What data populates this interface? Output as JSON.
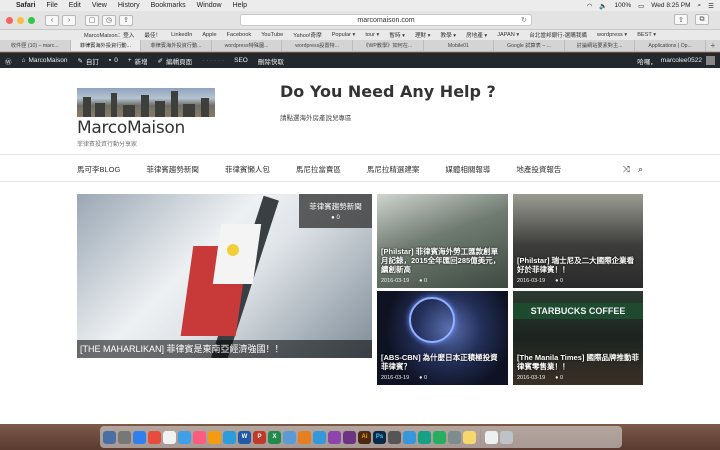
{
  "menubar": {
    "app": "Safari",
    "items": [
      "File",
      "Edit",
      "View",
      "History",
      "Bookmarks",
      "Window",
      "Help"
    ],
    "battery": "100%",
    "clock": "Wed 8:25 PM"
  },
  "toolbar": {
    "url": "marcomaison.com"
  },
  "bookmarks": [
    "MarcoMaison：登入",
    "最佳！",
    "LinkedIn",
    "Apple",
    "Facebook",
    "YouTube",
    "Yahoo!奇摩",
    "Popular ▾",
    "tour ▾",
    "暫時 ▾",
    "理財 ▾",
    "教學 ▾",
    "房地產 ▾",
    "JAPAN ▾",
    "台北當邦銀行-選購我備",
    "wordpress ▾",
    "BEST ▾"
  ],
  "tabs": [
    "收件匣 (10) – marc...",
    "菲律賓海外投資行動...",
    "菲律賓海外投資行動...",
    "wordpress特殊圖...",
    "wordpress設置特...",
    "《WP教學》如何在...",
    "Mobile01",
    "Google 試算表 – ...",
    "討論網站要素對主...",
    "Applications | Op..."
  ],
  "wpbar": {
    "site": "MarcoMaison",
    "customize": "自訂",
    "comments": "0",
    "new": "新增",
    "edit": "編輯頁面",
    "seo": "SEO",
    "cache": "刪除快取",
    "greeting": "哈囉，",
    "user": "marcolee0522"
  },
  "site": {
    "title": "MarcoMaison",
    "tagline": "菲律賓投資行動分享家",
    "ad_title": "Do You Need Any Help ?",
    "ad_subtitle": "請點選海外房產說兒專區"
  },
  "nav": [
    "馬可李BLOG",
    "菲律賓趨勢新聞",
    "菲律賓懶人包",
    "馬尼拉當賣區",
    "馬尼拉精選建案",
    "媒體相關報導",
    "地產投資報告"
  ],
  "featured": {
    "title": "[THE MAHARLIKAN] 菲律賓是東南亞經濟強國！！",
    "category": "菲律賓趨勢新聞",
    "comments": "0"
  },
  "cards": [
    {
      "title": "[Philstar] 菲律賓海外勞工匯款創單月記錄，2015全年匯回285億美元，續創新高",
      "date": "2016-03-19",
      "comments": "0"
    },
    {
      "title": "[Philstar] 瑞士尼及二大國際企業看好於菲律賓！！",
      "date": "2016-03-19",
      "comments": "0"
    },
    {
      "title": "[ABS-CBN] 為什麼日本正積極投資菲律賓？",
      "date": "2016-03-19",
      "comments": "0"
    },
    {
      "title": "[The Manila Times] 國際品牌推動菲律賓零售業！！",
      "date": "2016-03-19",
      "comments": "0"
    }
  ]
}
